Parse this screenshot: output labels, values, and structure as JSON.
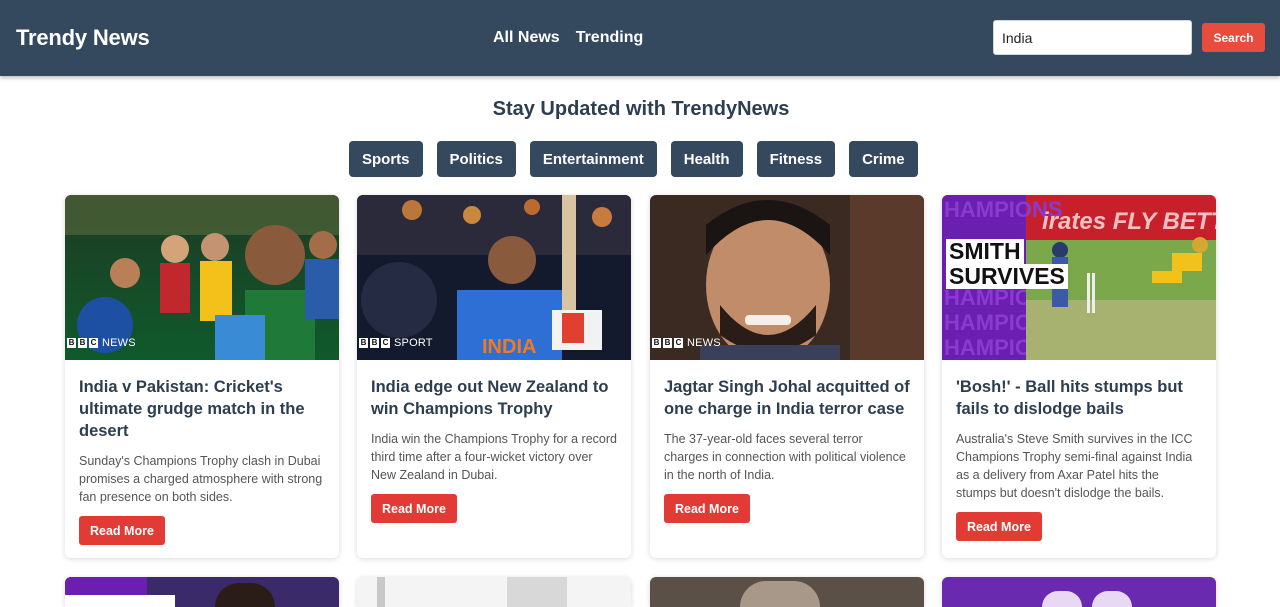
{
  "navbar": {
    "brand": "Trendy News",
    "links": [
      "All News",
      "Trending"
    ],
    "search": {
      "value": "India",
      "button": "Search"
    }
  },
  "headline": "Stay Updated with TrendyNews",
  "categories": [
    "Sports",
    "Politics",
    "Entertainment",
    "Health",
    "Fitness",
    "Crime"
  ],
  "articles": [
    {
      "title": "India v Pakistan: Cricket's ultimate grudge match in the desert",
      "description": "Sunday's Champions Trophy clash in Dubai promises a charged atmosphere with strong fan presence on both sides.",
      "button": "Read More",
      "image_badge": "NEWS"
    },
    {
      "title": "India edge out New Zealand to win Champions Trophy",
      "description": "India win the Champions Trophy for a record third time after a four-wicket victory over New Zealand in Dubai.",
      "button": "Read More",
      "image_badge": "SPORT",
      "image_text": "INDIA"
    },
    {
      "title": "Jagtar Singh Johal acquitted of one charge in India terror case",
      "description": "The 37-year-old faces several terror charges in connection with political violence in the north of India.",
      "button": "Read More",
      "image_badge": "NEWS"
    },
    {
      "title": "'Bosh!' - Ball hits stumps but fails to dislodge bails",
      "description": "Australia's Steve Smith survives in the ICC Champions Trophy semi-final against India as a delivery from Axar Patel hits the stumps but doesn't dislodge the bails.",
      "button": "Read More",
      "image_overlay": [
        "SMITH",
        "SURVIVES"
      ],
      "image_banner": "irates FLY BETTER",
      "image_side_text": "HAMPIONS"
    }
  ],
  "colors": {
    "navbar": "#34495e",
    "accent": "#e74c3c",
    "text": "#2c3e50"
  }
}
